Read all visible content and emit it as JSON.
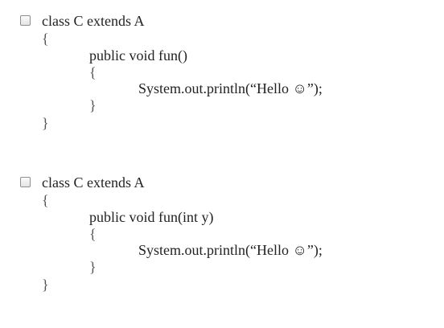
{
  "options": [
    {
      "checked": false,
      "lines": {
        "class_decl": "class C extends A",
        "open_class": "{",
        "method_decl": "public void fun()",
        "open_method": "{",
        "statement": "System.out.println(“Hello ☺”);",
        "close_method": "}",
        "close_class": "}"
      }
    },
    {
      "checked": false,
      "lines": {
        "class_decl": "class C extends A",
        "open_class": "{",
        "method_decl": "public void fun(int y)",
        "open_method": "{",
        "statement": "System.out.println(“Hello ☺”);",
        "close_method": "}",
        "close_class": "}"
      }
    }
  ]
}
